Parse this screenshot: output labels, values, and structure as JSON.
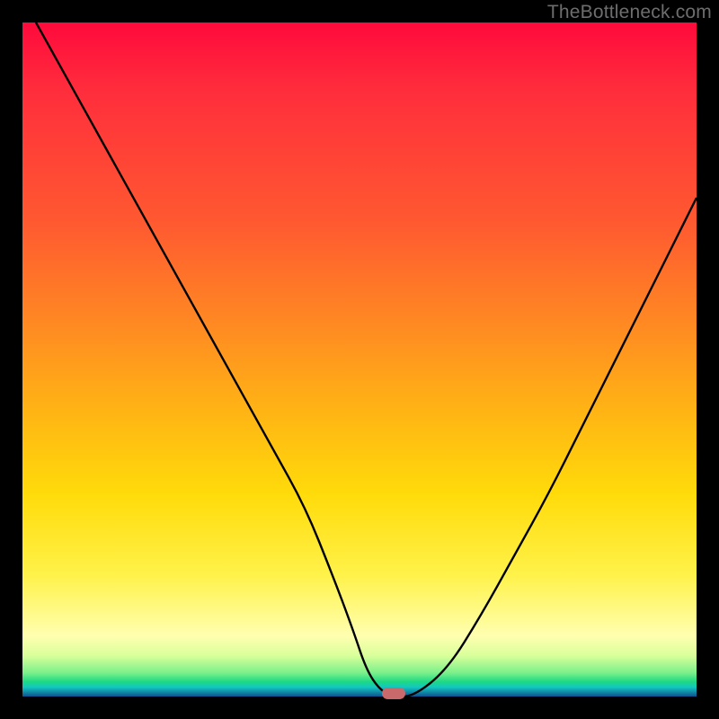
{
  "watermark": "TheBottleneck.com",
  "colors": {
    "frame": "#000000",
    "curve_stroke": "#000000",
    "marker": "#c9696b",
    "watermark_text": "#6d6d6d"
  },
  "chart_data": {
    "type": "line",
    "title": "",
    "xlabel": "",
    "ylabel": "",
    "xlim": [
      0,
      100
    ],
    "ylim": [
      0,
      100
    ],
    "series": [
      {
        "name": "bottleneck-curve",
        "x": [
          2,
          7,
          12,
          17,
          22,
          27,
          32,
          37,
          42,
          46,
          49,
          51,
          53,
          55,
          58,
          63,
          68,
          73,
          78,
          83,
          88,
          93,
          98,
          100
        ],
        "values": [
          100,
          91,
          82,
          73,
          64,
          55,
          46,
          37,
          28,
          18,
          10,
          4,
          1,
          0,
          0,
          4,
          12,
          21,
          30,
          40,
          50,
          60,
          70,
          74
        ]
      }
    ],
    "annotations": [
      {
        "name": "optimal-marker",
        "x": 55,
        "y": 0.5,
        "shape": "pill",
        "color": "#c9696b"
      }
    ],
    "background_gradient": {
      "direction": "vertical",
      "stops": [
        {
          "pos": 0,
          "color": "#ff0a3c"
        },
        {
          "pos": 0.45,
          "color": "#ff8a22"
        },
        {
          "pos": 0.82,
          "color": "#fff24a"
        },
        {
          "pos": 0.965,
          "color": "#7af08a"
        },
        {
          "pos": 1.0,
          "color": "#105090"
        }
      ]
    }
  }
}
